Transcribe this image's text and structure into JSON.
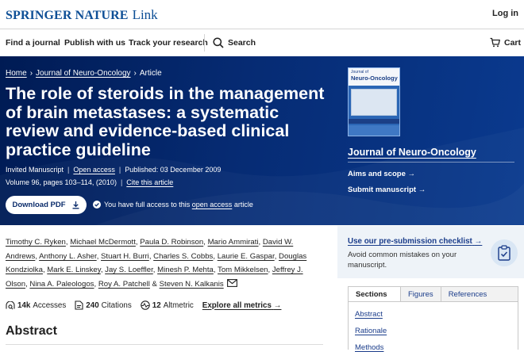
{
  "header": {
    "brand": "SPRINGER NATURE",
    "brand_suffix": "Link",
    "login": "Log in"
  },
  "nav": {
    "find_journal": "Find a journal",
    "publish": "Publish with us",
    "track": "Track your research",
    "search": "Search",
    "cart": "Cart"
  },
  "breadcrumb": {
    "home": "Home",
    "journal": "Journal of Neuro-Oncology",
    "article": "Article"
  },
  "article": {
    "title": "The role of steroids in the management of brain metastases: a systematic review and evidence-based clinical practice guideline",
    "type": "Invited Manuscript",
    "open_access": "Open access",
    "published": "Published: 03 December 2009",
    "volume": "Volume 96, pages 103–114, (2010)",
    "cite": "Cite this article",
    "download": "Download PDF",
    "access_prefix": "You have full access to this",
    "access_link": "open access",
    "access_suffix": "article"
  },
  "journal_panel": {
    "cover_title_small": "Journal of",
    "cover_title": "Neuro-Oncology",
    "name": "Journal of Neuro-Oncology",
    "aims": "Aims and scope",
    "submit": "Submit manuscript"
  },
  "authors": [
    "Timothy C. Ryken",
    "Michael McDermott",
    "Paula D. Robinson",
    "Mario Ammirati",
    "David W. Andrews",
    "Anthony L. Asher",
    "Stuart H. Burri",
    "Charles S. Cobbs",
    "Laurie E. Gaspar",
    "Douglas Kondziolka",
    "Mark E. Linskey",
    "Jay S. Loeffler",
    "Minesh P. Mehta",
    "Tom Mikkelsen",
    "Jeffrey J. Olson",
    "Nina A. Paleologos",
    "Roy A. Patchell",
    "Steven N. Kalkanis"
  ],
  "metrics": {
    "accesses_value": "14k",
    "accesses_label": "Accesses",
    "citations_value": "240",
    "citations_label": "Citations",
    "altmetric_value": "12",
    "altmetric_label": "Altmetric",
    "explore": "Explore all metrics"
  },
  "abstract_heading": "Abstract",
  "sidebar": {
    "checklist_link": "Use our pre-submission checklist",
    "checklist_desc": "Avoid common mistakes on your manuscript.",
    "tabs": [
      "Sections",
      "Figures",
      "References"
    ],
    "sections": [
      "Abstract",
      "Rationale",
      "Methods"
    ]
  },
  "colors": {
    "brand_blue": "#0e4f96",
    "hero_dark": "#001b54",
    "hero_light": "#0a3a8f",
    "link_blue": "#1a3c8a"
  }
}
